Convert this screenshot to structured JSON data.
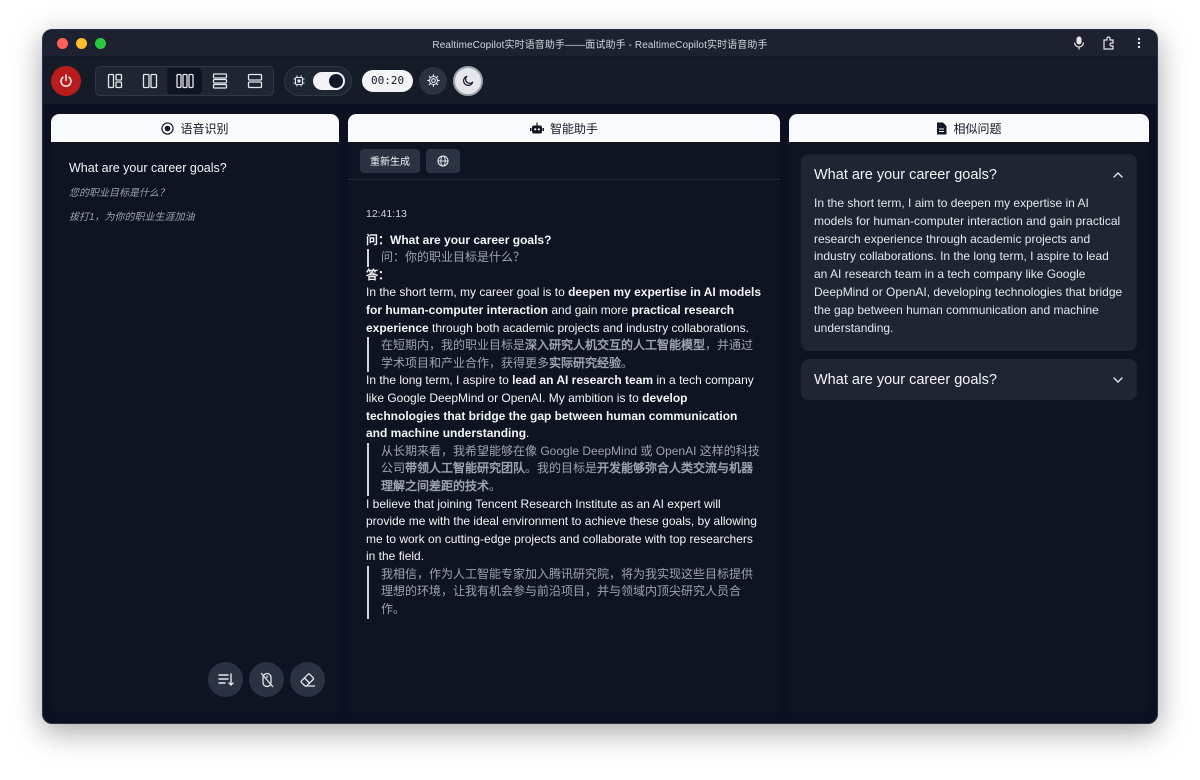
{
  "window": {
    "title": "RealtimeCopilot实时语音助手——面试助手 - RealtimeCopilot实时语音助手"
  },
  "toolbar": {
    "timer": "00:20",
    "layouts": [
      "layout-sidebar-left",
      "layout-two-columns",
      "layout-three-columns",
      "layout-rows",
      "layout-two-rows"
    ],
    "active_layout": 2,
    "toggle_on": true
  },
  "asr": {
    "header": "语音识别",
    "en": "What are your career goals?",
    "zh": "您的职业目标是什么？",
    "note": "拔打1，为你的职业生涯加油"
  },
  "assistant": {
    "header": "智能助手",
    "regenerate_label": "重新生成",
    "timestamp": "12:41:13",
    "q_prefix": "问：",
    "question": "What are your career goals?",
    "question_zh": "问：你的职业目标是什么？",
    "a_prefix": "答：",
    "p1": {
      "a": "In the short term, my career goal is to ",
      "b": "deepen my expertise in AI models for human-computer interaction",
      "c": " and gain more ",
      "d": "practical research experience",
      "e": " through both academic projects and industry collaborations."
    },
    "p1_zh": {
      "a": "在短期内，我的职业目标是",
      "b": "深入研究人机交互的人工智能模型",
      "c": "，并通过学术项目和产业合作，获得更多",
      "d": "实际研究经验",
      "e": "。"
    },
    "p2": {
      "a": "In the long term, I aspire to ",
      "b": "lead an AI research team",
      "c": " in a tech company like Google DeepMind or OpenAI. My ambition is to ",
      "d": "develop technologies that bridge the gap between human communication and machine understanding",
      "e": "."
    },
    "p2_zh": {
      "a": "从长期来看，我希望能够在像 Google DeepMind 或 OpenAI 这样的科技公司",
      "b": "带领人工智能研究团队",
      "c": "。我的目标是",
      "d": "开发能够弥合人类交流与机器理解之间差距的技术",
      "e": "。"
    },
    "p3": "I believe that joining Tencent Research Institute as an AI expert will provide me with the ideal environment to achieve these goals, by allowing me to work on cutting-edge projects and collaborate with top researchers in the field.",
    "p3_zh": "我相信，作为人工智能专家加入腾讯研究院，将为我实现这些目标提供理想的环境，让我有机会参与前沿项目，并与领域内顶尖研究人员合作。"
  },
  "similar": {
    "header": "相似问题",
    "cards": [
      {
        "title": "What are your career goals?",
        "expanded": true,
        "text": "In the short term, I aim to deepen my expertise in AI models for human-computer interaction and gain practical research experience through academic projects and industry collaborations. In the long term, I aspire to lead an AI research team in a tech company like Google DeepMind or OpenAI, developing technologies that bridge the gap between human communication and machine understanding."
      },
      {
        "title": "What are your career goals?",
        "expanded": false,
        "text": ""
      }
    ]
  },
  "colors": {
    "power": "#b91c1c",
    "window_bg": "#0b1120",
    "panel_bg": "#0f1422",
    "card_bg": "#1f2533"
  }
}
